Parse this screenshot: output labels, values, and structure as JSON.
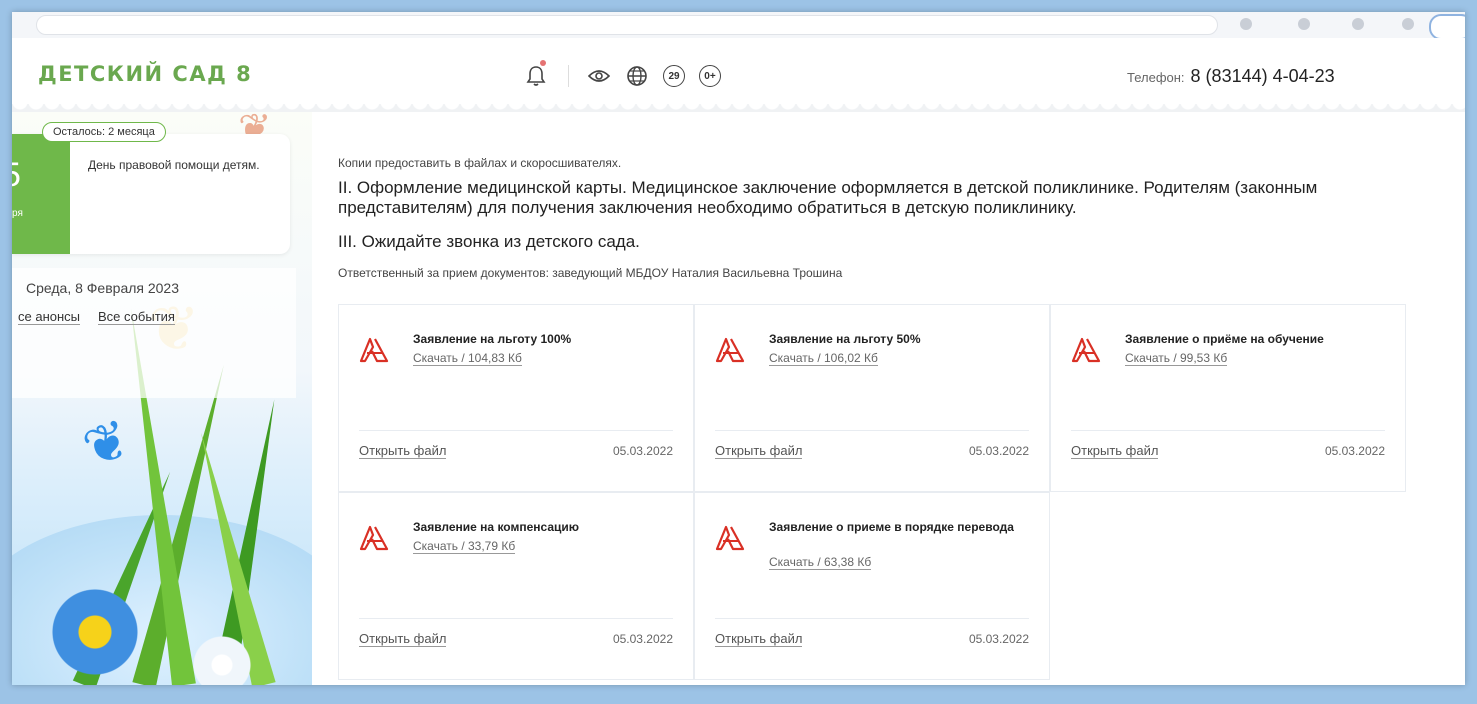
{
  "header": {
    "logo": "ДЕТСКИЙ САД 8",
    "icons": [
      "bell-icon",
      "eye-icon",
      "globe-icon",
      "region-29-icon",
      "age-0plus-icon"
    ],
    "region_badge": "29",
    "age_badge": "0+",
    "phone_label": "Телефон:",
    "phone_number": "8 (83144) 4-04-23"
  },
  "sidebar": {
    "event_badge": "Осталось: 2 месяца",
    "event_day": "5",
    "event_month": "ря",
    "event_title": "День правовой помощи детям.",
    "current_date": "Среда, 8 Февраля 2023",
    "link_announcements": "се анонсы",
    "link_events": "Все события"
  },
  "main": {
    "note": "Копии предоставить в файлах и скоросшивателях.",
    "step2": "II. Оформление медицинской карты. Медицинское заключение оформляется в детской поликлинике. Родителям (законным представителям) для получения заключения необходимо обратиться в детскую поликлинику.",
    "step3": "III. Ожидайте звонка из детского сада.",
    "responsible": "Ответственный за прием документов: заведующий МБДОУ Наталия Васильевна Трошина"
  },
  "documents": [
    {
      "title": "Заявление на льготу 100%",
      "download": "Скачать / 104,83 Кб",
      "open": "Открыть файл",
      "date": "05.03.2022"
    },
    {
      "title": "Заявление на льготу 50%",
      "download": "Скачать / 106,02 Кб",
      "open": "Открыть файл",
      "date": "05.03.2022"
    },
    {
      "title": "Заявление о приёме на обучение",
      "download": "Скачать / 99,53 Кб",
      "open": "Открыть файл",
      "date": "05.03.2022"
    },
    {
      "title": "Заявление на компенсацию",
      "download": "Скачать / 33,79 Кб",
      "open": "Открыть файл",
      "date": "05.03.2022"
    },
    {
      "title": "Заявление о приеме в порядке перевода",
      "download": "Скачать / 63,38 Кб",
      "open": "Открыть файл",
      "date": "05.03.2022"
    }
  ],
  "colors": {
    "brand_green": "#6aa84f",
    "pdf_red": "#d93025",
    "frame_blue": "#9cc3e6"
  }
}
